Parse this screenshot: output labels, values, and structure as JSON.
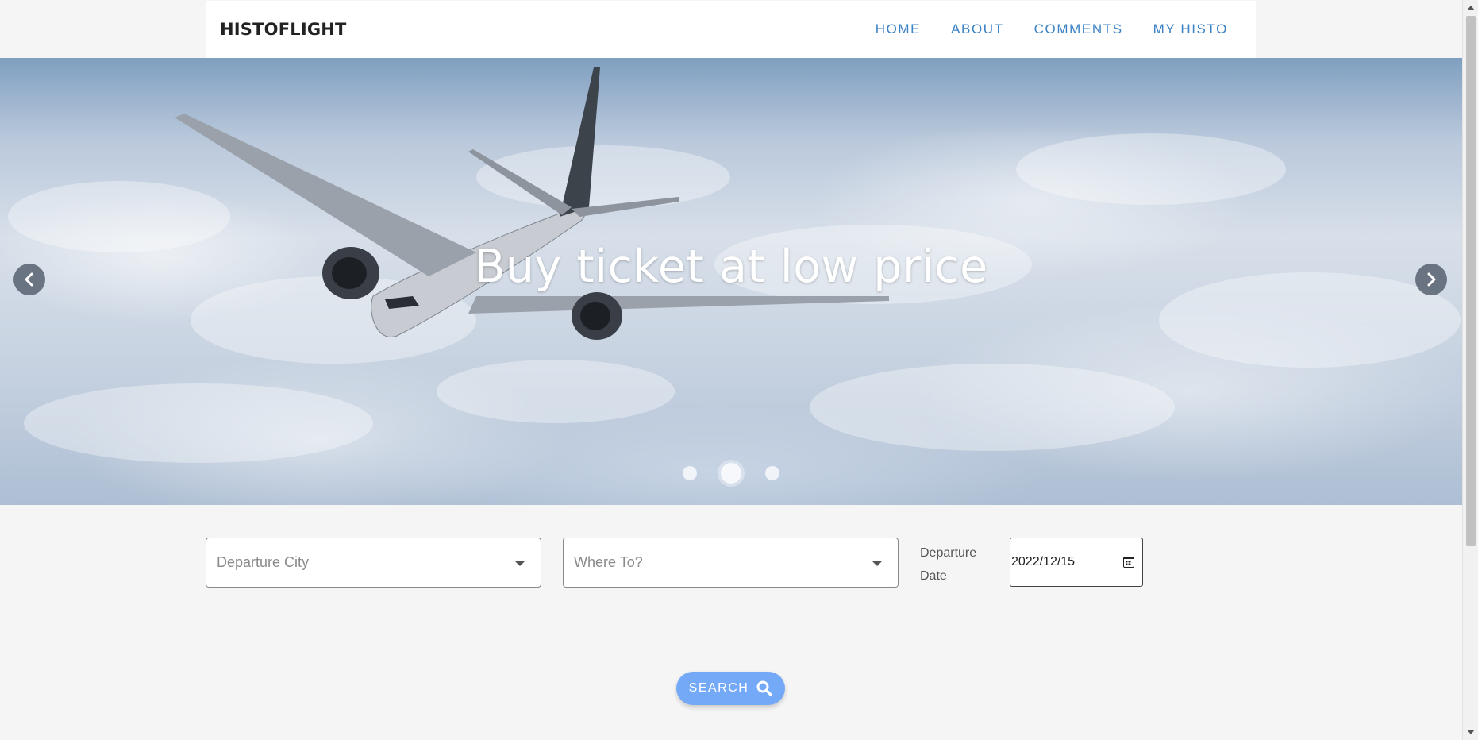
{
  "navbar": {
    "brand": "HISTOFLIGHT",
    "links": [
      "HOME",
      "ABOUT",
      "COMMENTS",
      "MY HISTO"
    ],
    "link_color": "#3b82c4"
  },
  "hero": {
    "title": "Buy ticket at low price",
    "prev_icon": "chevron-left-icon",
    "next_icon": "chevron-right-icon",
    "slides": 3,
    "active_slide": 2
  },
  "form": {
    "departure_city_placeholder": "Departure City",
    "destination_placeholder": "Where To?",
    "departure_date_label": "Departure Date",
    "departure_date_value": "2022/12/15",
    "search_label": "SEARCH",
    "search_icon": "search-icon",
    "accent": "#74a9f7"
  }
}
